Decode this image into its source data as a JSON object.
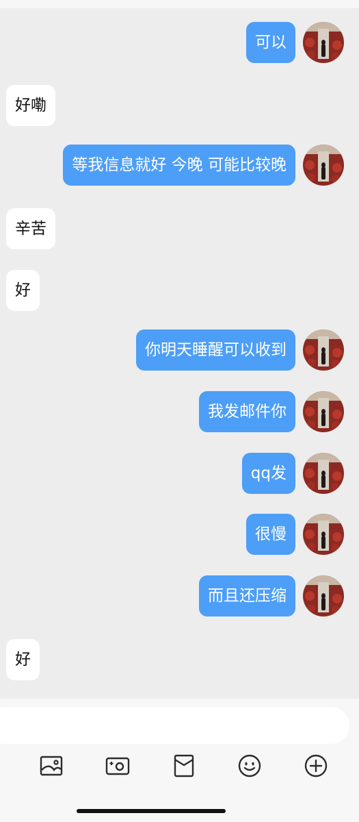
{
  "colors": {
    "chat_background": "#EDEDED",
    "outgoing_bubble": "#4D9EF7",
    "incoming_bubble": "#FFFFFF",
    "icon_color": "#2B2B2B"
  },
  "messages": [
    {
      "direction": "outgoing",
      "text": "可以"
    },
    {
      "direction": "incoming",
      "text": "好嘞"
    },
    {
      "direction": "outgoing",
      "text": "等我信息就好 今晚 可能比较晚"
    },
    {
      "direction": "incoming",
      "text": "辛苦"
    },
    {
      "direction": "incoming",
      "text": "好"
    },
    {
      "direction": "outgoing",
      "text": "你明天睡醒可以收到"
    },
    {
      "direction": "outgoing",
      "text": "我发邮件你"
    },
    {
      "direction": "outgoing",
      "text": "qq发"
    },
    {
      "direction": "outgoing",
      "text": "很慢"
    },
    {
      "direction": "outgoing",
      "text": "而且还压缩"
    },
    {
      "direction": "incoming",
      "text": "好"
    }
  ],
  "composer": {
    "input_value": ""
  },
  "toolbar": {
    "icons": [
      "image-icon",
      "camera-icon",
      "red-packet-icon",
      "emoji-icon",
      "plus-icon"
    ]
  }
}
